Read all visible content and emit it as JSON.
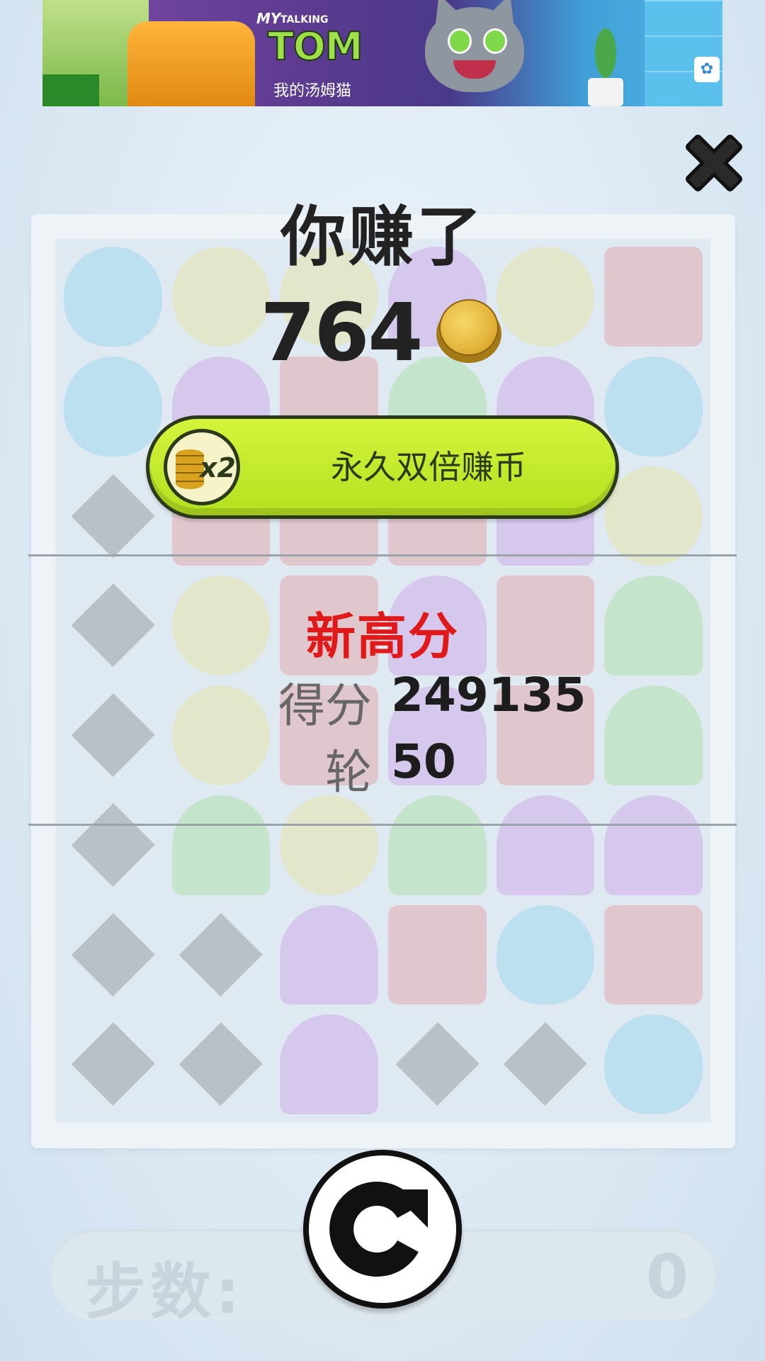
{
  "ad": {
    "logo_my": "MY",
    "logo_talking": "TALKING",
    "logo_tom": "TOM",
    "logo_cn": "我的汤姆猫"
  },
  "result": {
    "earned_title": "你赚了",
    "coins": "764",
    "double_button_label": "永久双倍赚币",
    "double_icon_text": "x2",
    "new_high_score": "新高分",
    "score_label": "得分",
    "score_value": "249135",
    "round_label": "轮",
    "round_value": "50"
  },
  "footer": {
    "moves_label": "步数:",
    "moves_value": "0"
  },
  "icons": {
    "close": "close-icon",
    "coin": "coin-icon",
    "restart": "restart-icon",
    "double_coins": "double-coins-icon"
  },
  "colors": {
    "new_high_score": "#e01a1a",
    "double_button": "#c4ea2c",
    "text_dark": "#222222"
  }
}
